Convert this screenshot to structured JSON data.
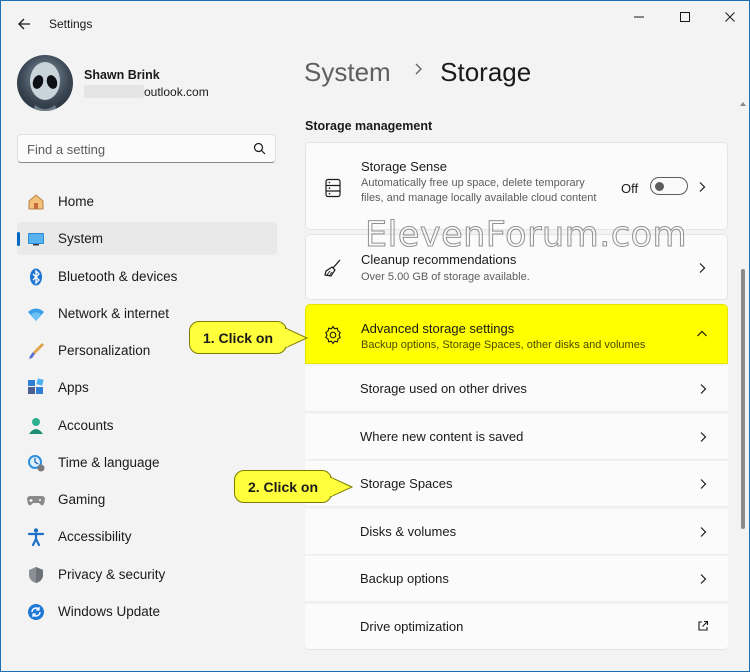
{
  "window": {
    "title": "Settings"
  },
  "profile": {
    "name": "Shawn Brink",
    "email_visible": "outlook.com"
  },
  "search": {
    "placeholder": "Find a setting"
  },
  "nav": [
    {
      "label": "Home",
      "icon": "home-icon",
      "active": false
    },
    {
      "label": "System",
      "icon": "system-icon",
      "active": true
    },
    {
      "label": "Bluetooth & devices",
      "icon": "bluetooth-icon",
      "active": false
    },
    {
      "label": "Network & internet",
      "icon": "network-icon",
      "active": false
    },
    {
      "label": "Personalization",
      "icon": "personalization-icon",
      "active": false
    },
    {
      "label": "Apps",
      "icon": "apps-icon",
      "active": false
    },
    {
      "label": "Accounts",
      "icon": "accounts-icon",
      "active": false
    },
    {
      "label": "Time & language",
      "icon": "time-language-icon",
      "active": false
    },
    {
      "label": "Gaming",
      "icon": "gaming-icon",
      "active": false
    },
    {
      "label": "Accessibility",
      "icon": "accessibility-icon",
      "active": false
    },
    {
      "label": "Privacy & security",
      "icon": "privacy-icon",
      "active": false
    },
    {
      "label": "Windows Update",
      "icon": "windows-update-icon",
      "active": false
    }
  ],
  "breadcrumb": {
    "parent": "System",
    "current": "Storage"
  },
  "section_title": "Storage management",
  "storage_sense": {
    "title": "Storage Sense",
    "description": "Automatically free up space, delete temporary files, and manage locally available cloud content",
    "toggle_state": "Off"
  },
  "cleanup": {
    "title": "Cleanup recommendations",
    "description": "Over 5.00 GB of storage available."
  },
  "advanced": {
    "title": "Advanced storage settings",
    "description": "Backup options, Storage Spaces, other disks and volumes"
  },
  "advanced_items": [
    {
      "label": "Storage used on other drives",
      "action": "chevron"
    },
    {
      "label": "Where new content is saved",
      "action": "chevron"
    },
    {
      "label": "Storage Spaces",
      "action": "chevron"
    },
    {
      "label": "Disks & volumes",
      "action": "chevron"
    },
    {
      "label": "Backup options",
      "action": "chevron"
    },
    {
      "label": "Drive optimization",
      "action": "external-link"
    }
  ],
  "callouts": {
    "first": "1. Click on",
    "second": "2. Click on"
  },
  "watermark": "ElevenForum.com",
  "colors": {
    "accent": "#0067c0",
    "callout": "#ffff3c",
    "highlight": "#ffff00"
  }
}
